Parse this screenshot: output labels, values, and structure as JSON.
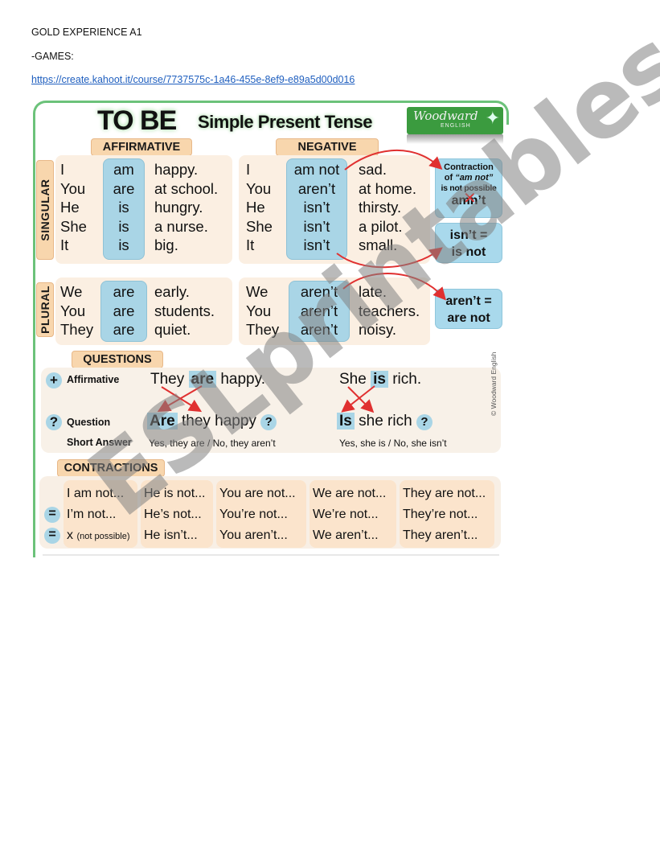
{
  "document": {
    "heading": "GOLD EXPERIENCE A1",
    "section": "-GAMES:",
    "link": "https://create.kahoot.it/course/7737575c-1a46-455e-8ef9-e89a5d00d016"
  },
  "infographic": {
    "title": "TO BE",
    "subtitle": "Simple Present Tense",
    "logo": {
      "name": "Woodward",
      "sub": "ENGLISH"
    },
    "tags": {
      "affirmative": "AFFIRMATIVE",
      "negative": "NEGATIVE",
      "singular": "SINGULAR",
      "plural": "PLURAL",
      "questions": "QUESTIONS",
      "contractions": "CONTRACTIONS"
    },
    "singular": {
      "affirmative": [
        {
          "subject": "I",
          "verb": "am",
          "complement": "happy."
        },
        {
          "subject": "You",
          "verb": "are",
          "complement": "at school."
        },
        {
          "subject": "He",
          "verb": "is",
          "complement": "hungry."
        },
        {
          "subject": "She",
          "verb": "is",
          "complement": "a nurse."
        },
        {
          "subject": "It",
          "verb": "is",
          "complement": "big."
        }
      ],
      "negative": [
        {
          "subject": "I",
          "verb": "am not",
          "complement": "sad."
        },
        {
          "subject": "You",
          "verb": "aren’t",
          "complement": "at home."
        },
        {
          "subject": "He",
          "verb": "isn’t",
          "complement": "thirsty."
        },
        {
          "subject": "She",
          "verb": "isn’t",
          "complement": "a pilot."
        },
        {
          "subject": "It",
          "verb": "isn’t",
          "complement": "small."
        }
      ]
    },
    "plural": {
      "affirmative": [
        {
          "subject": "We",
          "verb": "are",
          "complement": "early."
        },
        {
          "subject": "You",
          "verb": "are",
          "complement": "students."
        },
        {
          "subject": "They",
          "verb": "are",
          "complement": "quiet."
        }
      ],
      "negative": [
        {
          "subject": "We",
          "verb": "aren’t",
          "complement": "late."
        },
        {
          "subject": "You",
          "verb": "aren’t",
          "complement": "teachers."
        },
        {
          "subject": "They",
          "verb": "aren’t",
          "complement": "noisy."
        }
      ]
    },
    "notes": {
      "amnot": {
        "line1": "Contraction",
        "line2_pre": "of ",
        "line2_em": "“am not”",
        "line3": "is not possible",
        "crossed": "amn’t"
      },
      "isnt": {
        "line1": "isn’t =",
        "line2": "is not"
      },
      "arent": {
        "line1": "aren’t =",
        "line2": "are not"
      }
    },
    "questions": {
      "affirmative_label": "Affirmative",
      "question_label": "Question",
      "short_answer_label": "Short Answer",
      "plus_icon": "+",
      "question_icon": "?",
      "ex1": {
        "subject": "They",
        "verb": "are",
        "rest": "happy.",
        "q_verb": "Are",
        "q_rest": "they happy",
        "answer": "Yes, they are / No, they aren’t"
      },
      "ex2": {
        "subject": "She",
        "verb": "is",
        "rest": "rich.",
        "q_verb": "Is",
        "q_rest": "she rich",
        "answer": "Yes, she is / No, she isn’t"
      },
      "copyright": "© Woodward English"
    },
    "contractions": {
      "eq_icon": "=",
      "columns": [
        {
          "full": "I am not...",
          "short1": "I’m not...",
          "short2_x": "x",
          "short2_note": "(not possible)"
        },
        {
          "full": "He is not...",
          "short1": "He’s not...",
          "short2": "He isn’t..."
        },
        {
          "full": "You are not...",
          "short1": "You’re not...",
          "short2": "You aren’t..."
        },
        {
          "full": "We are not...",
          "short1": "We’re not...",
          "short2": "We aren’t..."
        },
        {
          "full": "They are not...",
          "short1": "They’re not...",
          "short2": "They aren’t..."
        }
      ]
    },
    "colors": {
      "frame_green": "#6cc27a",
      "tag_orange": "#f8d6ad",
      "verb_blue": "#a9d5e6",
      "arrow_red": "#e03030"
    }
  },
  "watermark": "ESLprintables.com"
}
